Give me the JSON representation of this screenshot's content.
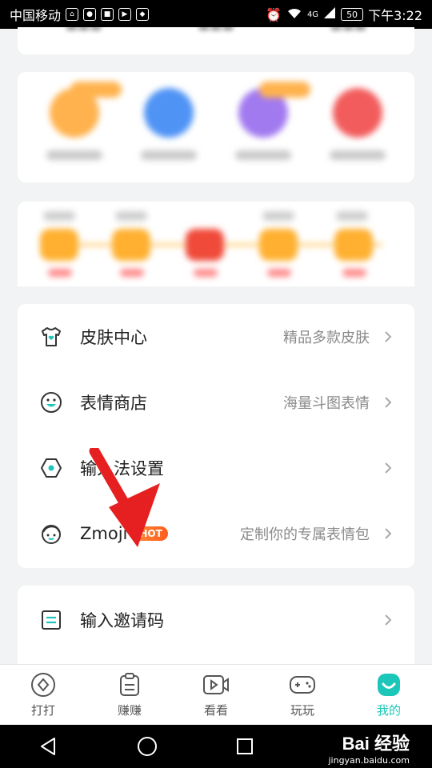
{
  "status_bar": {
    "carrier": "中国移动",
    "network": "4G",
    "battery": "50",
    "time": "下午3:22"
  },
  "menu": {
    "items": [
      {
        "title": "皮肤中心",
        "subtitle": "精品多款皮肤",
        "icon": "tshirt-icon"
      },
      {
        "title": "表情商店",
        "subtitle": "海量斗图表情",
        "icon": "smiley-icon"
      },
      {
        "title": "输入法设置",
        "subtitle": "",
        "icon": "settings-hexagon-icon"
      },
      {
        "title": "Zmoji",
        "badge": "HOT",
        "subtitle": "定制你的专属表情包",
        "icon": "face-avatar-icon"
      }
    ],
    "invite": {
      "title": "输入邀请码",
      "icon": "invite-code-icon"
    }
  },
  "tabs": [
    {
      "label": "打打",
      "icon": "diamond-icon"
    },
    {
      "label": "赚赚",
      "icon": "clipboard-icon"
    },
    {
      "label": "看看",
      "icon": "video-icon"
    },
    {
      "label": "玩玩",
      "icon": "gamepad-icon"
    },
    {
      "label": "我的",
      "icon": "smile-profile-icon",
      "active": true
    }
  ],
  "watermark": {
    "logo": "Bai 经验",
    "url": "jingyan.baidu.com"
  },
  "colors": {
    "accent": "#1cc6b8",
    "hot": "#ff6a2a",
    "arrow": "#e62020"
  }
}
